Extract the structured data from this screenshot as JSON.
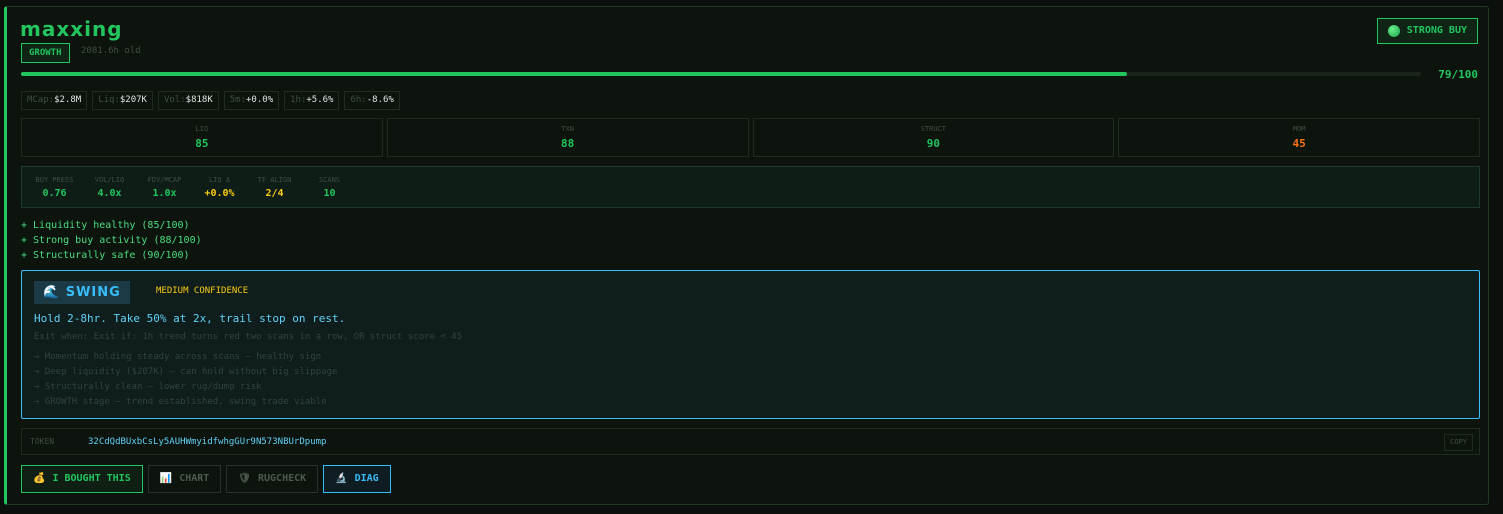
{
  "token": {
    "name": "maxxing",
    "stage": "GROWTH",
    "age": "2081.6h old",
    "signal": "STRONG BUY",
    "score": 79,
    "score_label": "79/100"
  },
  "metrics": [
    {
      "label": "MCap:",
      "value": "$2.8M"
    },
    {
      "label": "Liq:",
      "value": "$207K"
    },
    {
      "label": "Vol:",
      "value": "$818K"
    },
    {
      "label": "5m:",
      "value": "+0.0%"
    },
    {
      "label": "1h:",
      "value": "+5.6%"
    },
    {
      "label": "6h:",
      "value": "-8.6%"
    }
  ],
  "subscores": [
    {
      "label": "LIQ",
      "value": "85",
      "color": "#22c55e"
    },
    {
      "label": "TXN",
      "value": "88",
      "color": "#22c55e"
    },
    {
      "label": "STRUCT",
      "value": "90",
      "color": "#22c55e"
    },
    {
      "label": "MOM",
      "value": "45",
      "color": "#f97316"
    }
  ],
  "stats": [
    {
      "label": "BUY PRESS",
      "value": "0.76",
      "color": "#22c55e"
    },
    {
      "label": "VOL/LIQ",
      "value": "4.0x",
      "color": "#22c55e"
    },
    {
      "label": "FDV/MCAP",
      "value": "1.0x",
      "color": "#22c55e"
    },
    {
      "label": "LIQ Δ",
      "value": "+0.0%",
      "color": "#facc15"
    },
    {
      "label": "TF ALIGN",
      "value": "2/4",
      "color": "#facc15"
    },
    {
      "label": "SCANS",
      "value": "10",
      "color": "#22c55e"
    }
  ],
  "reasons": [
    "+ Liquidity healthy (85/100)",
    "+ Strong buy activity (88/100)",
    "+ Structurally safe (90/100)"
  ],
  "strategy": {
    "badge": "🌊 SWING",
    "confidence": "MEDIUM CONFIDENCE",
    "plan": "Hold 2-8hr. Take 50% at 2x, trail stop on rest.",
    "exit": "Exit when: Exit if: 1h trend turns red two scans in a row, OR struct score < 45",
    "notes": [
      "→ Momentum holding steady across scans — healthy sign",
      "→ Deep liquidity ($207K) — can hold without big slippage",
      "→ Structurally clean — lower rug/dump risk",
      "→ GROWTH stage — trend established, swing trade viable"
    ]
  },
  "address": {
    "label": "TOKEN",
    "value": "32CdQdBUxbCsLy5AUHWmyidfwhgGUr9N573NBUrDpump",
    "copy_label": "COPY"
  },
  "actions": {
    "bought": {
      "icon": "💰",
      "label": "I BOUGHT THIS"
    },
    "chart": {
      "icon": "📊",
      "label": "CHART"
    },
    "rugcheck": {
      "icon": "🛡",
      "label": "RUGCHECK"
    },
    "diag": {
      "icon": "🔬",
      "label": "DIAG"
    }
  },
  "colors": {
    "accent": "#22c55e",
    "strategy": "#38bdf8",
    "warn": "#facc15",
    "mom": "#f97316"
  }
}
